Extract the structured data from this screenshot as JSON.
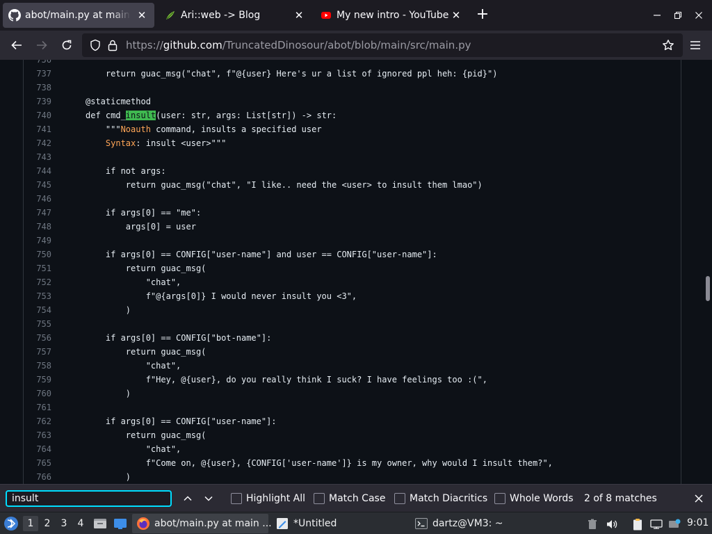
{
  "browser": {
    "tabs": [
      {
        "title": "abot/main.py at main · Tr",
        "icon": "github-icon",
        "active": true
      },
      {
        "title": "Ari::web -> Blog",
        "icon": "leaf-icon",
        "active": false
      },
      {
        "title": "My new intro - YouTube",
        "icon": "youtube-icon",
        "active": false
      }
    ],
    "url_prefix": "https://",
    "url_host": "github.com",
    "url_path": "/TruncatedDinosour/abot/blob/main/src/main.py"
  },
  "code": {
    "lines": [
      {
        "n": "736",
        "text": ""
      },
      {
        "n": "737",
        "text": "        return guac_msg(\"chat\", f\"@{user} Here's ur a list of ignored ppl heh: {pid}\")"
      },
      {
        "n": "738",
        "text": ""
      },
      {
        "n": "739",
        "text": "    @staticmethod"
      },
      {
        "n": "740",
        "text": "    def cmd_insult(user: str, args: List[str]) -> str:"
      },
      {
        "n": "741",
        "text": "        \"\"\"Noauth command, insults a specified user"
      },
      {
        "n": "742",
        "text": "        Syntax: insult <user>\"\"\""
      },
      {
        "n": "743",
        "text": ""
      },
      {
        "n": "744",
        "text": "        if not args:"
      },
      {
        "n": "745",
        "text": "            return guac_msg(\"chat\", \"I like.. need the <user> to insult them lmao\")"
      },
      {
        "n": "746",
        "text": ""
      },
      {
        "n": "747",
        "text": "        if args[0] == \"me\":"
      },
      {
        "n": "748",
        "text": "            args[0] = user"
      },
      {
        "n": "749",
        "text": ""
      },
      {
        "n": "750",
        "text": "        if args[0] == CONFIG[\"user-name\"] and user == CONFIG[\"user-name\"]:"
      },
      {
        "n": "751",
        "text": "            return guac_msg("
      },
      {
        "n": "752",
        "text": "                \"chat\","
      },
      {
        "n": "753",
        "text": "                f\"@{args[0]} I would never insult you <3\","
      },
      {
        "n": "754",
        "text": "            )"
      },
      {
        "n": "755",
        "text": ""
      },
      {
        "n": "756",
        "text": "        if args[0] == CONFIG[\"bot-name\"]:"
      },
      {
        "n": "757",
        "text": "            return guac_msg("
      },
      {
        "n": "758",
        "text": "                \"chat\","
      },
      {
        "n": "759",
        "text": "                f\"Hey, @{user}, do you really think I suck? I have feelings too :(\","
      },
      {
        "n": "760",
        "text": "            )"
      },
      {
        "n": "761",
        "text": ""
      },
      {
        "n": "762",
        "text": "        if args[0] == CONFIG[\"user-name\"]:"
      },
      {
        "n": "763",
        "text": "            return guac_msg("
      },
      {
        "n": "764",
        "text": "                \"chat\","
      },
      {
        "n": "765",
        "text": "                f\"Come on, @{user}, {CONFIG['user-name']} is my owner, why would I insult them?\","
      },
      {
        "n": "766",
        "text": "            )"
      }
    ],
    "highlight_word": "insult",
    "highlight_line": "740",
    "accent_words": [
      "Noauth",
      "Syntax"
    ]
  },
  "findbar": {
    "query": "insult",
    "highlight_all": "Highlight All",
    "match_case": "Match Case",
    "match_diacritics": "Match Diacritics",
    "whole_words": "Whole Words",
    "status": "2 of 8 matches"
  },
  "taskbar": {
    "workspaces": [
      "1",
      "2",
      "3",
      "4"
    ],
    "active_workspace": "1",
    "tasks": [
      {
        "label": "abot/main.py at main ...",
        "icon": "firefox-icon",
        "active": true
      },
      {
        "label": "*Untitled",
        "icon": "text-editor-icon",
        "active": false
      },
      {
        "label": "dartz@VM3: ~",
        "icon": "terminal-icon",
        "active": false
      }
    ],
    "clock": "9:01"
  },
  "colors": {
    "accent": "#00ddff",
    "find_highlight": "#3fb950",
    "code_bg": "#0d1117",
    "docstring_accent": "#ffa657"
  }
}
